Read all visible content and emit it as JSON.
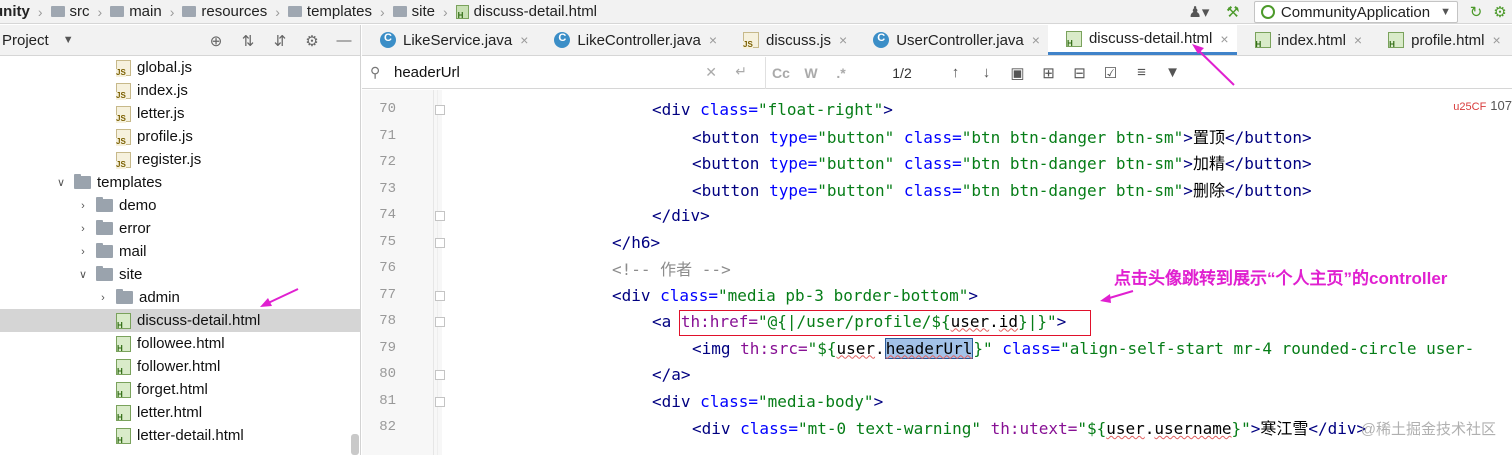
{
  "breadcrumb": [
    "unity",
    "src",
    "main",
    "resources",
    "templates",
    "site",
    "discuss-detail.html"
  ],
  "run_config": {
    "label": "CommunityApplication"
  },
  "project_pane": {
    "title": "Project"
  },
  "tree": [
    {
      "label": "global.js",
      "type": "js",
      "depth": 6
    },
    {
      "label": "index.js",
      "type": "js",
      "depth": 6
    },
    {
      "label": "letter.js",
      "type": "js",
      "depth": 6
    },
    {
      "label": "profile.js",
      "type": "js",
      "depth": 6
    },
    {
      "label": "register.js",
      "type": "js",
      "depth": 6
    },
    {
      "label": "templates",
      "type": "folder",
      "depth": 3,
      "expanded": true
    },
    {
      "label": "demo",
      "type": "folder",
      "depth": 4,
      "expanded": false
    },
    {
      "label": "error",
      "type": "folder",
      "depth": 4,
      "expanded": false
    },
    {
      "label": "mail",
      "type": "folder",
      "depth": 4,
      "expanded": false
    },
    {
      "label": "site",
      "type": "folder",
      "depth": 4,
      "expanded": true
    },
    {
      "label": "admin",
      "type": "folder",
      "depth": 5,
      "expanded": false
    },
    {
      "label": "discuss-detail.html",
      "type": "html",
      "depth": 6,
      "selected": true
    },
    {
      "label": "followee.html",
      "type": "html",
      "depth": 6
    },
    {
      "label": "follower.html",
      "type": "html",
      "depth": 6
    },
    {
      "label": "forget.html",
      "type": "html",
      "depth": 6
    },
    {
      "label": "letter.html",
      "type": "html",
      "depth": 6
    },
    {
      "label": "letter-detail.html",
      "type": "html",
      "depth": 6
    }
  ],
  "tabs": [
    {
      "label": "LikeService.java",
      "icon": "class"
    },
    {
      "label": "LikeController.java",
      "icon": "class"
    },
    {
      "label": "discuss.js",
      "icon": "js"
    },
    {
      "label": "UserController.java",
      "icon": "class"
    },
    {
      "label": "discuss-detail.html",
      "icon": "html",
      "active": true
    },
    {
      "label": "index.html",
      "icon": "html"
    },
    {
      "label": "profile.html",
      "icon": "html"
    }
  ],
  "search": {
    "value": "headerUrl",
    "match_count": "1/2",
    "options": [
      "Cc",
      "W",
      ".*"
    ]
  },
  "editor": {
    "line_numbers": [
      "70",
      "71",
      "72",
      "73",
      "74",
      "75",
      "76",
      "77",
      "78",
      "79",
      "80",
      "81",
      "82"
    ],
    "lines": {
      "l70": {
        "open": "<div",
        "a1": " class=",
        "v1": "\"float-right\"",
        "close": ">"
      },
      "l71": {
        "open": "<button",
        "a1": " type=",
        "v1": "\"button\"",
        "a2": " class=",
        "v2": "\"btn btn-danger btn-sm\"",
        "close": ">",
        "text": "置顶",
        "end": "</button>"
      },
      "l72": {
        "open": "<button",
        "a1": " type=",
        "v1": "\"button\"",
        "a2": " class=",
        "v2": "\"btn btn-danger btn-sm\"",
        "close": ">",
        "text": "加精",
        "end": "</button>"
      },
      "l73": {
        "open": "<button",
        "a1": " type=",
        "v1": "\"button\"",
        "a2": " class=",
        "v2": "\"btn btn-danger btn-sm\"",
        "close": ">",
        "text": "删除",
        "end": "</button>"
      },
      "l74": {
        "end": "</div>"
      },
      "l75": {
        "end": "</h6>"
      },
      "l76": {
        "comment": "<!-- 作者 -->"
      },
      "l77": {
        "open": "<div",
        "a1": " class=",
        "v1": "\"media pb-3 border-bottom\"",
        "close": ">"
      },
      "l78": {
        "open": "<a ",
        "th": "th:href=",
        "v1a": "\"@{|/user/profile/${",
        "v1b": "user",
        "v1c": ".",
        "v1d": "id",
        "v1e": "}|}\"",
        "close": ">"
      },
      "l79": {
        "open": "<img ",
        "th": "th:src=",
        "v1a": "\"${",
        "v1b": "user",
        "v1c": ".",
        "v1d": "headerUrl",
        "v1e": "}\"",
        "a2": " class=",
        "v2": "\"align-self-start mr-4 rounded-circle user-"
      },
      "l80": {
        "end": "</a>"
      },
      "l81": {
        "open": "<div",
        "a1": " class=",
        "v1": "\"media-body\"",
        "close": ">"
      },
      "l82": {
        "open": "<div",
        "a1": " class=",
        "v1": "\"mt-0 text-warning\"",
        "th": " th:utext=",
        "v2a": "\"${",
        "v2b": "user",
        "v2c": ".",
        "v2d": "username",
        "v2e": "}\"",
        "close": ">",
        "text": "寒江雪",
        "end": "</div>"
      }
    },
    "error_badge": "107"
  },
  "annotation": {
    "text": "点击头像跳转到展示“个人主页”的controller"
  },
  "watermark": "@稀土掘金技术社区",
  "colors": {
    "annotation_box": "#e0112b",
    "annotation_text": "#e020d0",
    "active_tab": "#4083c9"
  }
}
